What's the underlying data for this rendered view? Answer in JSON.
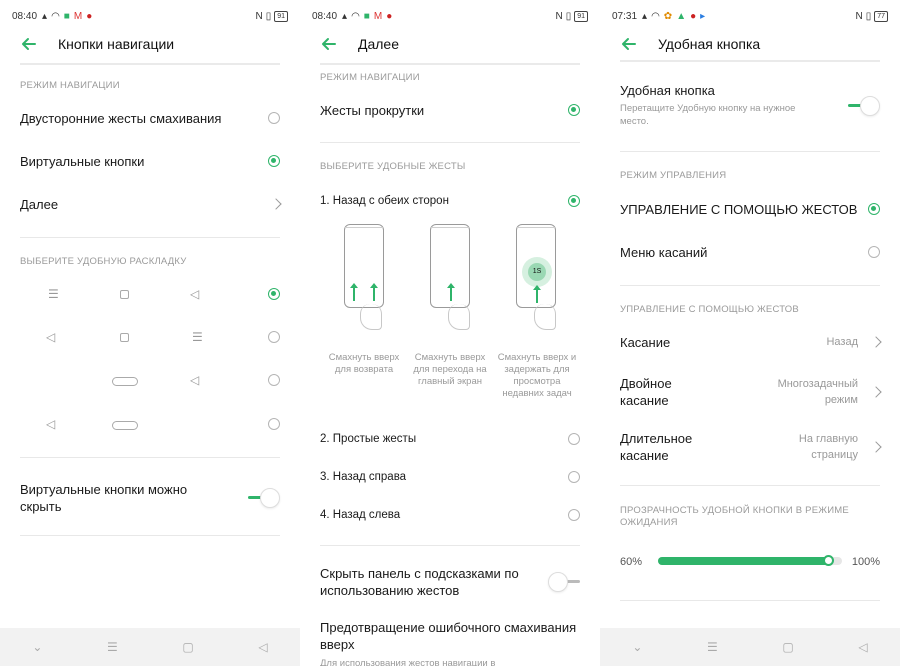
{
  "colors": {
    "accent": "#2fb46a",
    "text": "#111111",
    "muted": "#9a9a9a"
  },
  "s1": {
    "status": {
      "time": "08:40",
      "battery": "91"
    },
    "title": "Кнопки навигации",
    "section_nav": "РЕЖИМ НАВИГАЦИИ",
    "opt_gestures": "Двусторонние жесты смахивания",
    "opt_buttons": "Виртуальные кнопки",
    "more": "Далее",
    "section_layout": "ВЫБЕРИТЕ УДОБНУЮ РАСКЛАДКУ",
    "hide_buttons": "Виртуальные кнопки можно скрыть"
  },
  "s2": {
    "status": {
      "time": "08:40",
      "battery": "91"
    },
    "title": "Далее",
    "section_nav": "РЕЖИМ НАВИГАЦИИ",
    "opt_scroll": "Жесты прокрутки",
    "section_gestures": "ВЫБЕРИТЕ УДОБНЫЕ ЖЕСТЫ",
    "g1": "1. Назад с обеих сторон",
    "cap1": "Смахнуть вверх для возврата",
    "cap2": "Смахнуть вверх для перехода на главный экран",
    "cap3": "Смахнуть вверх и задержать для просмотра недавних задач",
    "hold_badge": "1S",
    "g2": "2. Простые жесты",
    "g3": "3. Назад справа",
    "g4": "4. Назад слева",
    "hide_hints": "Скрыть панель с подсказками по использованию жестов",
    "prevent": "Предотвращение ошибочного смахивания вверх",
    "prevent_sub": "Для использования жестов навигации в"
  },
  "s3": {
    "status": {
      "time": "07:31",
      "battery": "77"
    },
    "title": "Удобная кнопка",
    "assist": "Удобная кнопка",
    "assist_sub": "Перетащите Удобную кнопку на нужное место.",
    "section_mode": "РЕЖИМ УПРАВЛЕНИЯ",
    "opt_gesture": "УПРАВЛЕНИЕ С ПОМОЩЬЮ ЖЕСТОВ",
    "opt_menu": "Меню касаний",
    "section_gesture": "УПРАВЛЕНИЕ С ПОМОЩЬЮ ЖЕСТОВ",
    "tap": "Касание",
    "tap_val": "Назад",
    "double": "Двойное касание",
    "double_val": "Многозадачный режим",
    "long": "Длительное касание",
    "long_val": "На главную страницу",
    "section_opacity": "ПРОЗРАЧНОСТЬ УДОБНОЙ КНОПКИ В РЕЖИМЕ ОЖИДАНИЯ",
    "opacity_min": "60%",
    "opacity_max": "100%",
    "opacity_level": 0.95
  }
}
